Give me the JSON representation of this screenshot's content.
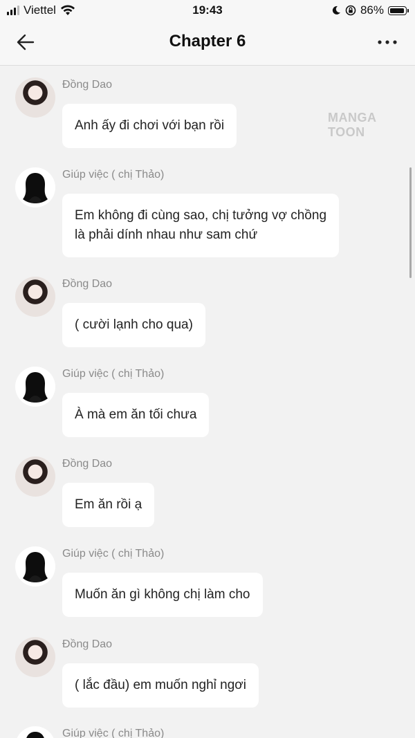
{
  "status_bar": {
    "carrier": "Viettel",
    "time": "19:43",
    "battery_percent": "86%",
    "battery_level": 0.86
  },
  "header": {
    "title": "Chapter 6",
    "back_icon": "arrow-left-icon",
    "more_icon": "more-horizontal-icon"
  },
  "watermark": "MANGA TOON",
  "messages": [
    {
      "sender": "Đồng Dao",
      "avatar": "girl",
      "text": [
        "Anh ấy đi chơi với bạn rồi"
      ]
    },
    {
      "sender": "Giúp việc ( chị Thảo)",
      "avatar": "silhouette",
      "text": [
        "Em không đi cùng sao, chị tưởng vợ chồng",
        "là phải dính nhau như sam chứ"
      ]
    },
    {
      "sender": "Đồng Dao",
      "avatar": "girl",
      "text": [
        "( cười lạnh cho qua)"
      ]
    },
    {
      "sender": "Giúp việc ( chị Thảo)",
      "avatar": "silhouette",
      "text": [
        "À mà em ăn tối chưa"
      ]
    },
    {
      "sender": "Đồng Dao",
      "avatar": "girl",
      "text": [
        "Em ăn rồi ạ"
      ]
    },
    {
      "sender": "Giúp việc ( chị Thảo)",
      "avatar": "silhouette",
      "text": [
        "Muốn ăn gì không chị làm cho"
      ]
    },
    {
      "sender": "Đồng Dao",
      "avatar": "girl",
      "text": [
        "( lắc đầu) em muốn nghỉ ngơi"
      ]
    },
    {
      "sender": "Giúp việc ( chị Thảo)",
      "avatar": "silhouette",
      "text": []
    }
  ]
}
